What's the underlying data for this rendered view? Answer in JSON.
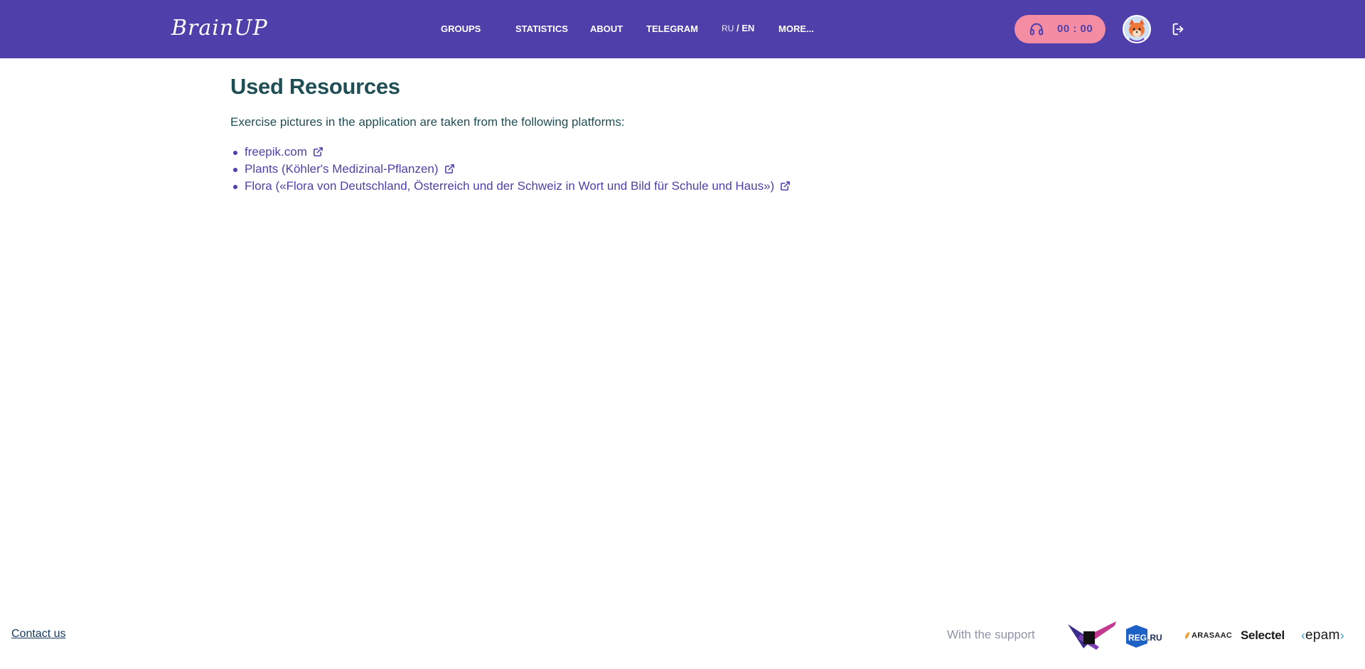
{
  "header": {
    "logo_text": "BrainUP",
    "nav": {
      "groups": "GROUPS",
      "statistics": "STATISTICS",
      "about": "ABOUT",
      "telegram": "TELEGRAM",
      "more": "MORE..."
    },
    "lang": {
      "ru": "RU",
      "separator": "/",
      "en": "EN"
    },
    "timer": {
      "value": "00 : 00",
      "icon": "headphones-icon"
    },
    "avatar_icon": "fox-avatar",
    "logout_icon": "logout-icon"
  },
  "main": {
    "title": "Used Resources",
    "intro": "Exercise pictures in the application are taken from the following platforms:",
    "resources": [
      {
        "label": "freepik.com",
        "icon": "external-link-icon"
      },
      {
        "label": "Plants (Köhler's Medizinal-Pflanzen)",
        "icon": "external-link-icon"
      },
      {
        "label": "Flora («Flora von Deutschland, Österreich und der Schweiz in Wort und Bild für Schule und Haus»)",
        "icon": "external-link-icon"
      }
    ]
  },
  "footer": {
    "contact": "Contact us",
    "support_label": "With the support",
    "sponsors": {
      "reg_main": "REG",
      "reg_suffix": ".RU",
      "arasaac": "ARASAAC",
      "selectel": "Selectel",
      "epam": "epam"
    }
  },
  "colors": {
    "header_bg": "#4e3fab",
    "timer_bg": "#f48da4",
    "link": "#4e3fab",
    "heading": "#1f4f55"
  }
}
